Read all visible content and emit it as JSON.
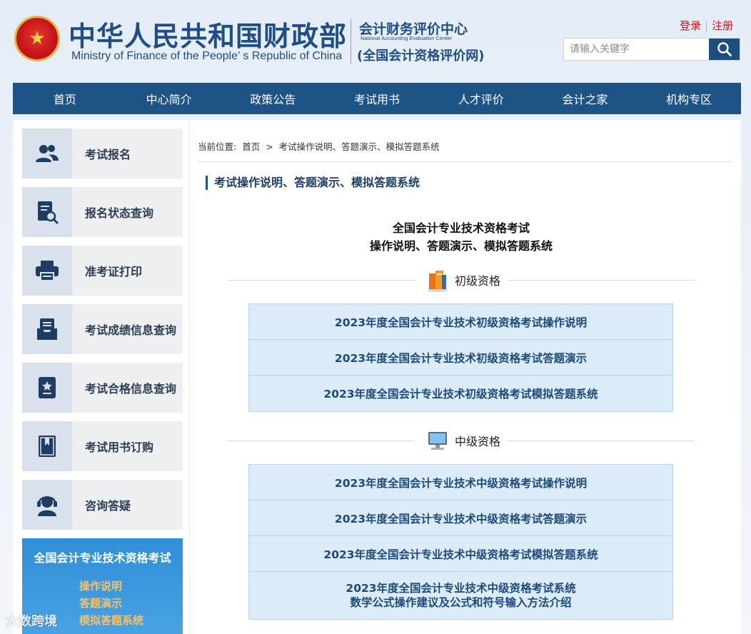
{
  "header": {
    "ministry_cn": "中华人民共和国财政部",
    "ministry_en": "Ministry of Finance of the People’ s Republic of China",
    "center_cn": "会计财务评价中心",
    "center_en": "National Accounting Evaluation Center",
    "center_net": "(全国会计资格评价网)",
    "login": "登录",
    "register": "注册",
    "search_placeholder": "请输入关键字",
    "emblem_color": "#c8161d"
  },
  "nav": [
    "首页",
    "中心简介",
    "政策公告",
    "考试用书",
    "人才评价",
    "会计之家",
    "机构专区"
  ],
  "sidebar": {
    "items": [
      {
        "label": "考试报名",
        "icon": "users-icon"
      },
      {
        "label": "报名状态查询",
        "icon": "document-search-icon"
      },
      {
        "label": "准考证打印",
        "icon": "printer-icon"
      },
      {
        "label": "考试成绩信息查询",
        "icon": "inbox-icon"
      },
      {
        "label": "考试合格信息查询",
        "icon": "certificate-icon"
      },
      {
        "label": "考试用书订购",
        "icon": "book-icon"
      },
      {
        "label": "咨询答疑",
        "icon": "headset-icon"
      }
    ],
    "box": {
      "title": "全国会计专业技术资格考试",
      "links": [
        "操作说明",
        "答题演示",
        "模拟答题系统"
      ]
    },
    "watermark": "大数跨境"
  },
  "main": {
    "breadcrumb": {
      "prefix": "当前位置:",
      "home": "首页",
      "sep": ">",
      "current": "考试操作说明、答题演示、模拟答题系统"
    },
    "section_title": "考试操作说明、答题演示、模拟答题系统",
    "doc_title_1": "全国会计专业技术资格考试",
    "doc_title_2": "操作说明、答题演示、模拟答题系统",
    "groups": [
      {
        "label": "初级资格",
        "icon": "books-icon",
        "links": [
          "2023年度全国会计专业技术初级资格考试操作说明",
          "2023年度全国会计专业技术初级资格考试答题演示",
          "2023年度全国会计专业技术初级资格考试模拟答题系统"
        ]
      },
      {
        "label": "中级资格",
        "icon": "computer-icon",
        "links": [
          "2023年度全国会计专业技术中级资格考试操作说明",
          "2023年度全国会计专业技术中级资格考试答题演示",
          "2023年度全国会计专业技术中级资格考试模拟答题系统"
        ],
        "tall_link": {
          "line1": "2023年度全国会计专业技术中级资格考试系统",
          "line2": "数学公式操作建议及公式和符号输入方法介绍"
        }
      }
    ]
  }
}
